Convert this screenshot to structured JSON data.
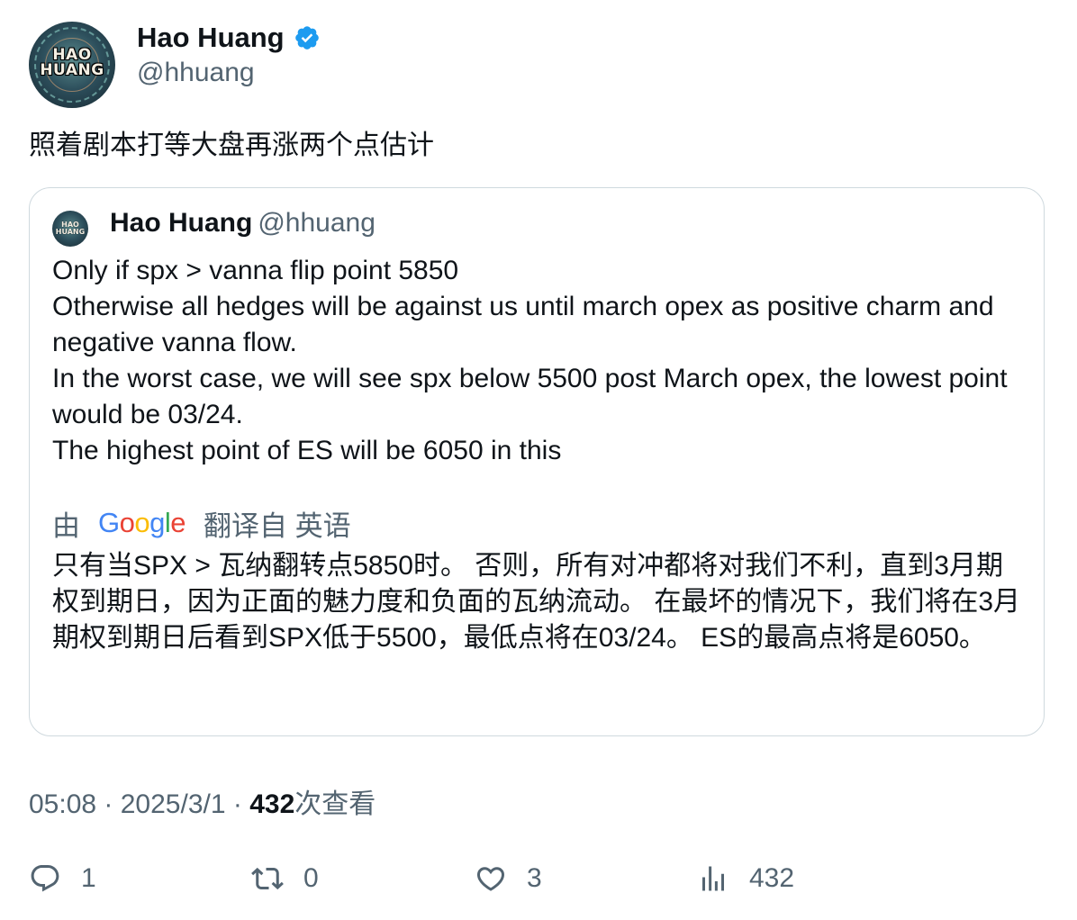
{
  "author": {
    "display_name": "Hao Huang",
    "handle": "@hhuang",
    "verified": true,
    "avatar_text_line1": "HAO",
    "avatar_text_line2": "HUANG",
    "verified_color": "#1d9bf0"
  },
  "tweet": {
    "text": "照着剧本打等大盘再涨两个点估计"
  },
  "quoted_tweet": {
    "display_name": "Hao Huang",
    "handle": "@hhuang",
    "lines": [
      "Only if spx > vanna flip point 5850",
      "Otherwise all hedges will be against us until march opex as positive charm and negative vanna flow.",
      "In the worst case, we will see spx below 5500 post March opex, the lowest point would be 03/24.",
      "The highest point of ES will be 6050 in this"
    ],
    "translation_prefix": "由",
    "translation_brand": "Google",
    "translation_suffix": "翻译自 英语",
    "translated_text": "只有当SPX > 瓦纳翻转点5850时。 否则，所有对冲都将对我们不利，直到3月期权到期日，因为正面的魅力度和负面的瓦纳流动。 在最坏的情况下，我们将在3月期权到期日后看到SPX低于5500，最低点将在03/24。 ES的最高点将是6050。"
  },
  "meta": {
    "time": "05:08",
    "separator1": " · ",
    "date": "2025/3/1",
    "separator2": " · ",
    "views_count": "432",
    "views_label": "次查看"
  },
  "actions": {
    "replies": "1",
    "retweets": "0",
    "likes": "3",
    "views": "432"
  },
  "colors": {
    "text_primary": "#0f1419",
    "text_secondary": "#536471",
    "border": "#cfd9de",
    "accent": "#1d9bf0"
  }
}
